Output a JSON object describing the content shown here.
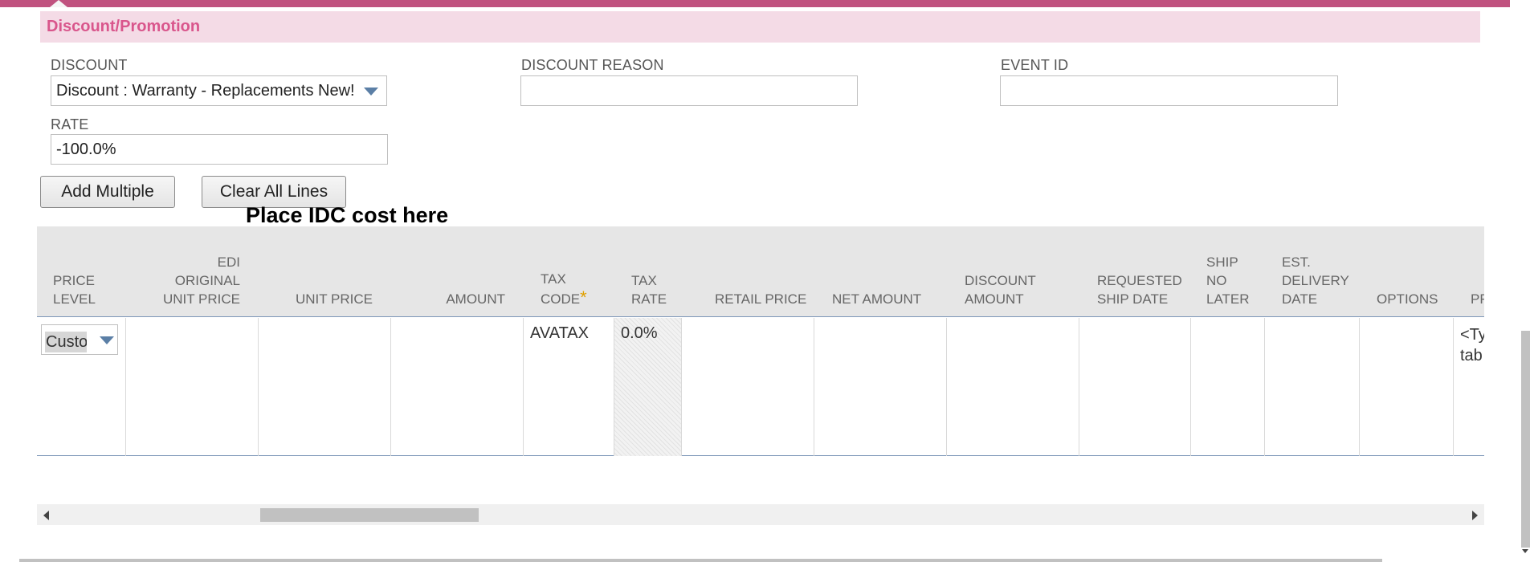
{
  "section": {
    "title": "Discount/Promotion"
  },
  "discount": {
    "label": "DISCOUNT",
    "value": "Discount : Warranty - Replacements New!"
  },
  "discount_reason": {
    "label": "DISCOUNT REASON",
    "value": ""
  },
  "event_id": {
    "label": "EVENT ID",
    "value": ""
  },
  "rate": {
    "label": "RATE",
    "value": "-100.0%"
  },
  "buttons": {
    "add_multiple": "Add Multiple",
    "clear_all_lines": "Clear All Lines"
  },
  "annotation": {
    "text": "Place IDC cost here"
  },
  "grid": {
    "columns": {
      "price_level_1": "PRICE",
      "price_level_2": "LEVEL",
      "edi_1": "EDI ORIGINAL",
      "edi_2": "UNIT PRICE",
      "unit_price": "UNIT PRICE",
      "amount": "AMOUNT",
      "tax_code_1": "TAX",
      "tax_code_2": "CODE",
      "tax_code_req": "*",
      "tax_rate_1": "TAX",
      "tax_rate_2": "RATE",
      "retail_price": "RETAIL PRICE",
      "net_amount": "NET AMOUNT",
      "discount_amount_1": "DISCOUNT",
      "discount_amount_2": "AMOUNT",
      "req_ship_1": "REQUESTED",
      "req_ship_2": "SHIP DATE",
      "ship_no_later_1": "SHIP",
      "ship_no_later_2": "NO",
      "ship_no_later_3": "LATER",
      "est_delivery_1": "EST.",
      "est_delivery_2": "DELIVERY",
      "est_delivery_3": "DATE",
      "options": "OPTIONS",
      "pr": "PR"
    },
    "row": {
      "price_level": "Custo",
      "tax_code": "AVATAX",
      "tax_rate": "0.0%",
      "last_1": "<Ty",
      "last_2": "tab"
    }
  }
}
